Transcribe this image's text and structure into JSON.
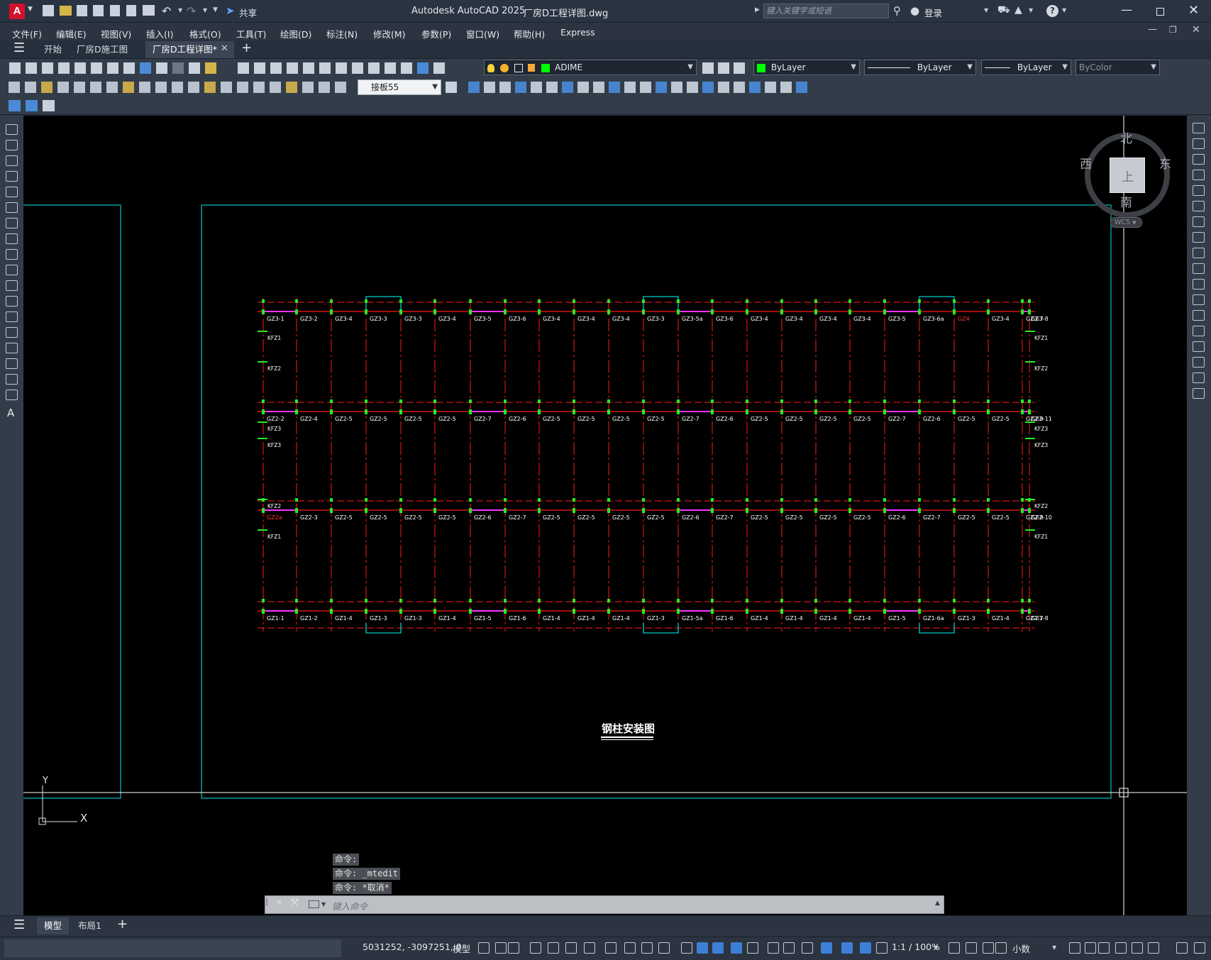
{
  "window": {
    "app_title": "Autodesk AutoCAD 2025",
    "file_title": "厂房D工程详图.dwg",
    "app_badge": "A",
    "share_label": "共享",
    "search_placeholder": "键入关键字或短语",
    "login_label": "登录"
  },
  "menus": [
    "文件(F)",
    "编辑(E)",
    "视图(V)",
    "插入(I)",
    "格式(O)",
    "工具(T)",
    "绘图(D)",
    "标注(N)",
    "修改(M)",
    "参数(P)",
    "窗口(W)",
    "帮助(H)",
    "Express"
  ],
  "doc_tabs": [
    {
      "label": "开始",
      "active": false
    },
    {
      "label": "厂房D施工图",
      "active": false
    },
    {
      "label": "厂房D工程详图*",
      "active": true
    }
  ],
  "toolbar": {
    "layer_name": "ADIME",
    "layer_color": "#00ff00",
    "color_value": "ByLayer",
    "linetype_value": "ByLayer",
    "lineweight_value": "ByLayer",
    "plotstyle_value": "ByColor",
    "dimstyle_value": "接板55"
  },
  "viewcube": {
    "north": "北",
    "south": "南",
    "east": "东",
    "west": "西",
    "top": "上",
    "wcs": "WCS"
  },
  "drawing": {
    "title": "钢柱安装图",
    "row_labels": [
      [
        "GZ3-1",
        "GZ3-2",
        "GZ3-4",
        "GZ3-3",
        "GZ3-3",
        "GZ3-4",
        "GZ3-5",
        "GZ3-6",
        "GZ3-4",
        "GZ3-4",
        "GZ3-4",
        "GZ3-3",
        "GZ3-5a",
        "GZ3-6",
        "GZ3-4",
        "GZ3-4",
        "GZ3-4",
        "GZ3-4",
        "GZ3-5",
        "GZ3-6a",
        "GZ4",
        "GZ3-4",
        "GZ3-7",
        "GZ3-8"
      ],
      [
        "GZ2-2",
        "GZ2-4",
        "GZ2-5",
        "GZ2-5",
        "GZ2-5",
        "GZ2-5",
        "GZ2-7",
        "GZ2-6",
        "GZ2-5",
        "GZ2-5",
        "GZ2-5",
        "GZ2-5",
        "GZ2-7",
        "GZ2-6",
        "GZ2-5",
        "GZ2-5",
        "GZ2-5",
        "GZ2-5",
        "GZ2-7",
        "GZ2-6",
        "GZ2-5",
        "GZ2-5",
        "GZ2-9",
        "GZ2-11"
      ],
      [
        "GZ2a",
        "GZ2-3",
        "GZ2-5",
        "GZ2-5",
        "GZ2-5",
        "GZ2-5",
        "GZ2-6",
        "GZ2-7",
        "GZ2-5",
        "GZ2-5",
        "GZ2-5",
        "GZ2-5",
        "GZ2-6",
        "GZ2-7",
        "GZ2-5",
        "GZ2-5",
        "GZ2-5",
        "GZ2-5",
        "GZ2-6",
        "GZ2-7",
        "GZ2-5",
        "GZ2-5",
        "GZ2-8",
        "GZ2-10"
      ],
      [
        "GZ1-1",
        "GZ1-2",
        "GZ1-4",
        "GZ1-3",
        "GZ1-3",
        "GZ1-4",
        "GZ1-5",
        "GZ1-6",
        "GZ1-4",
        "GZ1-4",
        "GZ1-4",
        "GZ1-3",
        "GZ1-5a",
        "GZ1-6",
        "GZ1-4",
        "GZ1-4",
        "GZ1-4",
        "GZ1-4",
        "GZ1-5",
        "GZ1-6a",
        "GZ1-3",
        "GZ1-4",
        "GZ1-7",
        "GZ1-8"
      ]
    ],
    "red_labels": [
      [
        0,
        20
      ],
      [
        2,
        0
      ]
    ],
    "side_labels": [
      {
        "t": "KFZ1",
        "lefty": 476,
        "side": "both"
      },
      {
        "t": "KFZ2",
        "lefty": 519,
        "side": "both"
      },
      {
        "t": "KFZ3",
        "lefty": 604,
        "side": "both"
      },
      {
        "t": "KFZ3",
        "lefty": 627,
        "side": "both"
      },
      {
        "t": "KFZ2",
        "lefty": 713,
        "side": "both"
      },
      {
        "t": "KFZ1",
        "lefty": 756,
        "side": "both"
      }
    ],
    "ucs_x": "X",
    "ucs_y": "Y"
  },
  "command": {
    "history": [
      "命令:",
      "命令: _mtedit",
      "命令: *取消*"
    ],
    "placeholder": "键入命令"
  },
  "layout_tabs": [
    {
      "label": "模型",
      "active": true
    },
    {
      "label": "布局1",
      "active": false
    }
  ],
  "status": {
    "coords": "5031252, -3097251, 0",
    "model": "模型",
    "scale": "1:1 / 100%",
    "units": "小数"
  }
}
